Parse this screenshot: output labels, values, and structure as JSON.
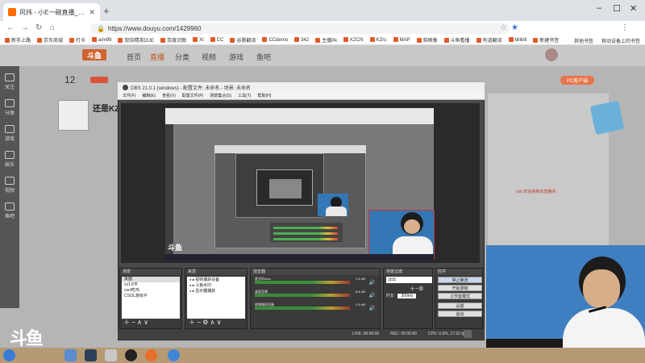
{
  "browser": {
    "tab_title": "风炜 - 小E一碗直播_反派精英",
    "url": "https://www.douyu.com/1429960",
    "bookmarks": [
      "新手上路",
      "京东商城",
      "打卡",
      "aim99",
      "双倍精英DUE",
      "百度识图",
      "XI",
      "CC",
      "谷歌翻译",
      "CCdemo",
      "342",
      "主播Pk",
      "KZCN",
      "KZru",
      "MAP",
      "斜映像",
      "斗鱼看播",
      "有道翻译",
      "bilibili",
      "新建书签"
    ],
    "bookmarks_right": [
      "其他书签",
      "移动设备上的书签"
    ]
  },
  "douyu": {
    "logo": "斗鱼",
    "nav": [
      "首页",
      "直播",
      "分类",
      "视频",
      "游戏",
      "鱼吧"
    ],
    "room_number": "12",
    "streamer_name": "还是KZ",
    "pc_button": "PC客户端",
    "ad_text": "ceb 欢迎来到本直播间",
    "sidebar": [
      "关注",
      "分类",
      "游戏",
      "娱乐",
      "视频",
      "鱼吧"
    ]
  },
  "obs": {
    "title": "OBS 21.0.1 (windows) - 配置文件: 未命名 - 场景: 未命名",
    "menu": [
      "文件(F)",
      "编辑(E)",
      "查看(V)",
      "配置文件(P)",
      "场景集合(S)",
      "工具(T)",
      "帮助(H)"
    ],
    "scenes_header": "场景",
    "scenes": [
      "桌面",
      "cs1.6平",
      "csol吃鸡",
      "CSOL游戏平"
    ],
    "sources_header": "来源",
    "sources": [
      "视频捕获设备",
      "斗鱼水印",
      "显示器捕获"
    ],
    "mixer_header": "混音器",
    "mixer": [
      {
        "name": "麦克风/Aux",
        "db": "0.0 dB"
      },
      {
        "name": "桌面音频",
        "db": "-8.6 dB"
      },
      {
        "name": "视频捕获设备",
        "db": "0.0 dB"
      }
    ],
    "transitions_header": "场景过渡",
    "transition": "淡出",
    "duration_label": "时长",
    "duration": "300ms",
    "controls_header": "控件",
    "controls": [
      "停止推流",
      "开始录制",
      "工作室模式",
      "设置",
      "退出"
    ],
    "status": {
      "live": "LIVE: 00:00:00",
      "rec": "REC: 00:00:00",
      "cpu": "CPU: 0.9%, 27.62 fps"
    },
    "preview_logo": "斗鱼"
  },
  "overlay": {
    "watermark": "斗鱼"
  },
  "colors": {
    "accent": "#d06430",
    "obs_bg": "#3a3a3a",
    "webcam_bg": "#3f7fc1"
  }
}
